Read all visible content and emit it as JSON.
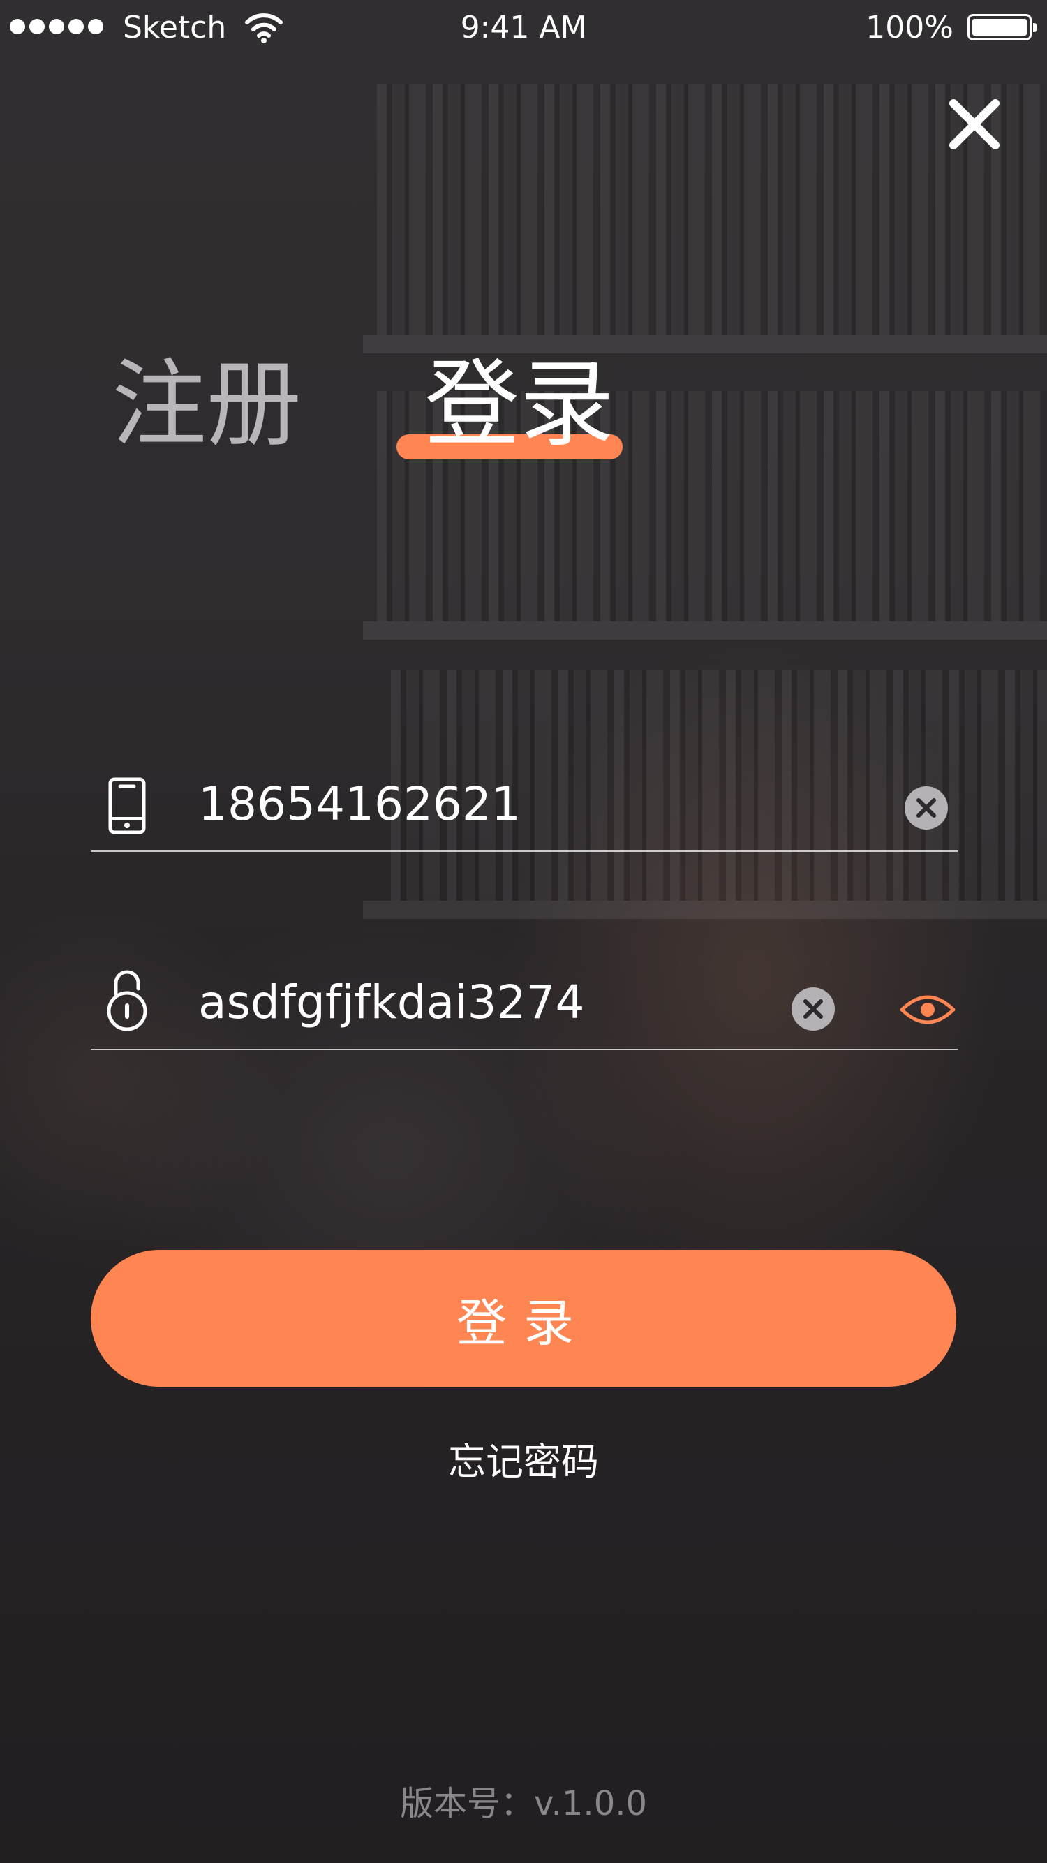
{
  "status_bar": {
    "carrier": "Sketch",
    "time": "9:41 AM",
    "battery": "100%"
  },
  "icons": {
    "close": "close-icon",
    "phone": "phone-icon",
    "lock": "lock-icon",
    "clear": "clear-circle-icon",
    "eye": "eye-icon",
    "wifi": "wifi-icon"
  },
  "tabs": [
    {
      "label": "注册",
      "active": false
    },
    {
      "label": "登录",
      "active": true
    }
  ],
  "form": {
    "phone_value": "18654162621",
    "password_value": "asdfgfjfkdai3274",
    "login_button": "登录",
    "forgot_password": "忘记密码"
  },
  "footer": {
    "version": "版本号：v.1.0.0"
  },
  "colors": {
    "accent": "#ff8653",
    "background": "#2c2a2d",
    "inactive_tab": "#b8b6b8"
  }
}
